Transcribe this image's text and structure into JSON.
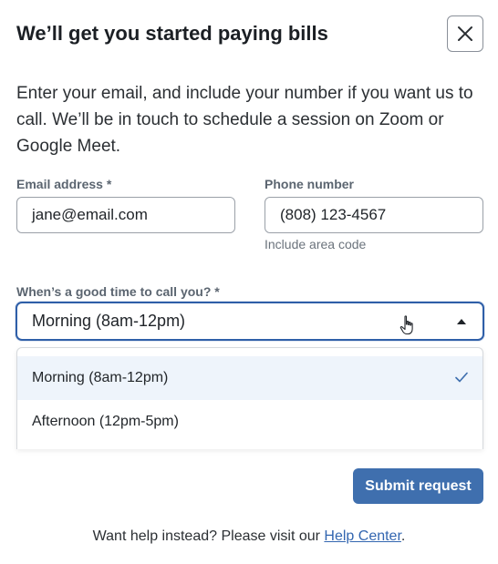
{
  "modal": {
    "title": "We’ll get you started paying bills",
    "intro": "Enter your email, and include your number if you want us to call. We’ll be in touch to schedule a session on Zoom or Google Meet."
  },
  "email": {
    "label": "Email address *",
    "value": "jane@email.com"
  },
  "phone": {
    "label": "Phone number",
    "value": "(808) 123-4567",
    "hint": "Include area code"
  },
  "call_time": {
    "label": "When’s a good time to call you? *",
    "selected": "Morning (8am-12pm)",
    "options": [
      {
        "label": "Morning (8am-12pm)",
        "selected": true
      },
      {
        "label": "Afternoon (12pm-5pm)",
        "selected": false
      }
    ]
  },
  "actions": {
    "submit_label": "Submit request"
  },
  "help": {
    "prefix": "Want help instead? Please visit our ",
    "link_text": "Help Center",
    "suffix": "."
  },
  "colors": {
    "primary": "#3f6fae",
    "focus_border": "#2f5fa8",
    "selected_bg": "#eef4fb",
    "link": "#3366b0"
  }
}
